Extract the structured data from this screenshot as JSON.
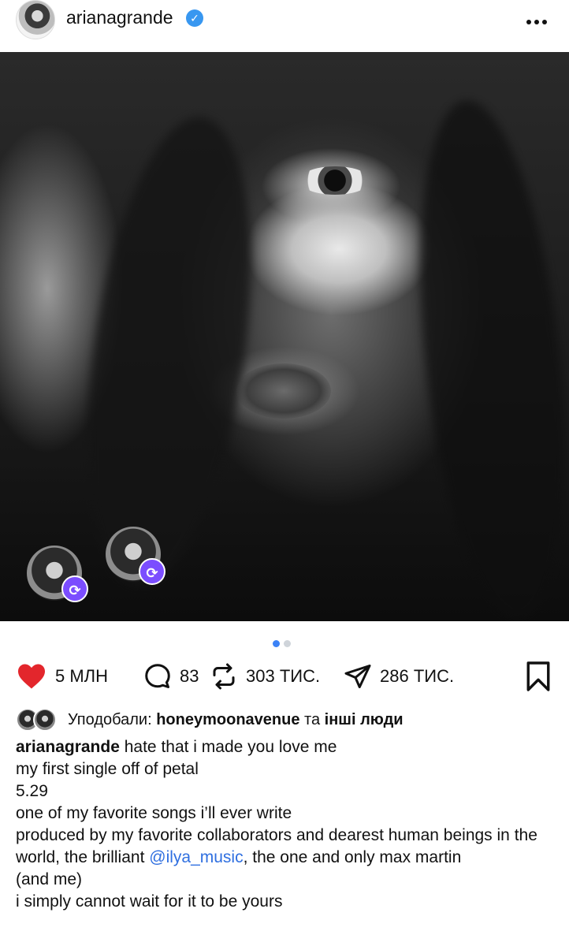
{
  "header": {
    "username": "arianagrande"
  },
  "photo": {
    "carousel_dots": 2,
    "active_dot": 1
  },
  "actions": {
    "likes": "5 МЛН",
    "comments": "83",
    "reposts": "303 ТИС.",
    "shares": "286 ТИС."
  },
  "liked_by": {
    "prefix": "Уподобали:",
    "user": "honeymoonavenue",
    "conj": "та",
    "others": "інші люди"
  },
  "caption": {
    "author": "arianagrande",
    "line1": "hate that i made you love me",
    "line2": "my first single off of petal",
    "line3": "5.29",
    "line4": "one of my favorite songs i’ll ever write",
    "line5a": "produced by my favorite collaborators and dearest human beings in the world, the brilliant",
    "line5_mention": "@ilya_music",
    "line5b": ", the one and only max martin",
    "line6": "(and me)",
    "line7": "i simply cannot wait for it to be yours"
  },
  "colors": {
    "verified": "#3897f0",
    "like_red": "#e3262c",
    "mention_blue": "#2f6fe0",
    "repost_badge": "#7b4dff",
    "active_dot": "#3b82f6"
  },
  "icons": [
    "avatar",
    "verified-icon",
    "more-icon",
    "heart-icon",
    "comment-icon",
    "repost-icon",
    "share-icon",
    "bookmark-icon"
  ]
}
